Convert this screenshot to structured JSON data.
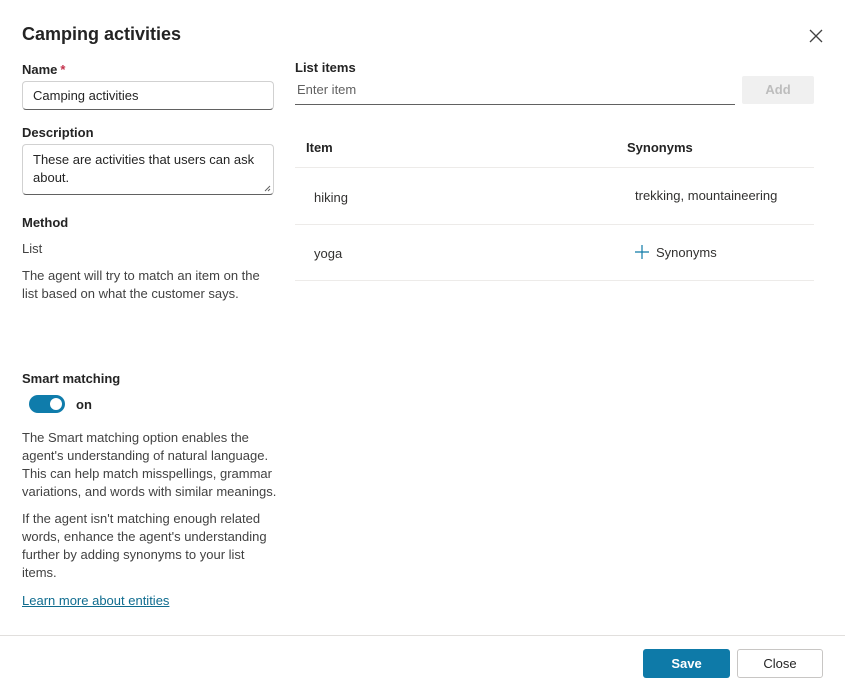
{
  "dialog": {
    "title": "Camping activities",
    "close_icon": "close-icon"
  },
  "form": {
    "name_label": "Name",
    "name_required_mark": "*",
    "name_value": "Camping activities",
    "description_label": "Description",
    "description_value": "These are activities that users can ask about.",
    "method_label": "Method",
    "method_value": "List",
    "method_help": "The agent will try to match an item on the list based on what the customer says.",
    "smart_matching_label": "Smart matching",
    "smart_matching_state": "on",
    "smart_matching_enabled": true,
    "smart_matching_help_1": "The Smart matching option enables the agent's understanding of natural language. This can help match misspellings, grammar variations, and words with similar meanings.",
    "smart_matching_help_2": "If the agent isn't matching enough related words, enhance the agent's understanding further by adding synonyms to your list items.",
    "learn_more_link": "Learn more about entities"
  },
  "list": {
    "label": "List items",
    "input_placeholder": "Enter item",
    "add_label": "Add",
    "columns": [
      "Item",
      "Synonyms"
    ],
    "rows": [
      {
        "item": "hiking",
        "synonyms": "trekking, mountaineering"
      },
      {
        "item": "yoga",
        "synonyms": "",
        "add_synonyms_label": "Synonyms"
      }
    ]
  },
  "footer": {
    "save_label": "Save",
    "close_label": "Close"
  },
  "colors": {
    "accent": "#0e7aa8",
    "required": "#c4314b",
    "link": "#0f6c8f"
  }
}
